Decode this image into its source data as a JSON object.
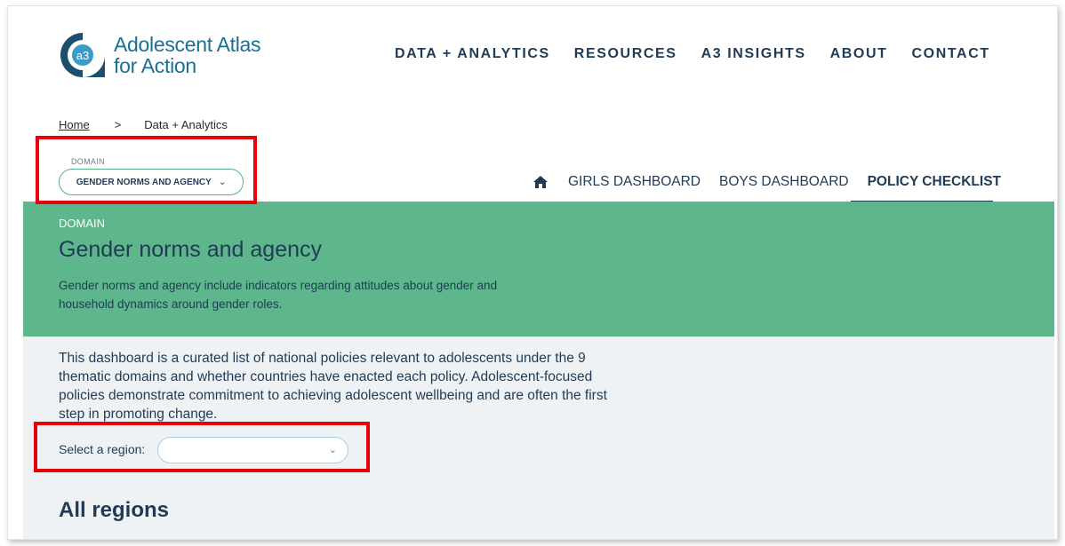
{
  "brand": {
    "name_line1": "Adolescent Atlas",
    "name_line2": "for Action",
    "logo_glyph": "a3",
    "color": "#1a6f93"
  },
  "top_nav": [
    {
      "label": "DATA + ANALYTICS"
    },
    {
      "label": "RESOURCES"
    },
    {
      "label": "A3 INSIGHTS"
    },
    {
      "label": "ABOUT"
    },
    {
      "label": "CONTACT"
    }
  ],
  "breadcrumb": {
    "home": "Home",
    "separator": ">",
    "current": "Data + Analytics"
  },
  "domain_selector": {
    "label": "DOMAIN",
    "value": "GENDER NORMS AND AGENCY",
    "icon": "chevron-down-icon"
  },
  "sub_nav": {
    "home_icon": "home-icon",
    "tabs": [
      {
        "label": "GIRLS DASHBOARD",
        "active": false
      },
      {
        "label": "BOYS DASHBOARD",
        "active": false
      },
      {
        "label": "POLICY CHECKLIST",
        "active": true
      }
    ]
  },
  "band": {
    "kicker": "DOMAIN",
    "title": "Gender norms and agency",
    "description": "Gender norms and agency include indicators regarding attitudes about gender and household dynamics around gender roles.",
    "color": "#5db68c"
  },
  "content": {
    "intro": "This dashboard is a curated list of national policies relevant to adolescents under the 9 thematic domains and whether countries have enacted each policy. Adolescent-focused policies demonstrate commitment to achieving adolescent wellbeing and are often the first step in promoting change.",
    "region_label": "Select a region:",
    "region_value": "",
    "heading": "All regions"
  },
  "highlight_color": "#e8000b"
}
